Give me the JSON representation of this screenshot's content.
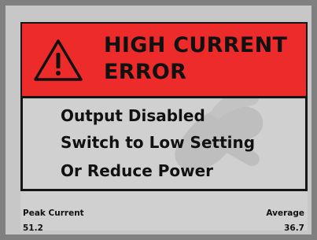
{
  "alert": {
    "title": "HIGH CURRENT ERROR",
    "icon": "warning-triangle-icon",
    "header_color": "#ee2b2b"
  },
  "messages": [
    "Output Disabled",
    "Switch to Low Setting",
    "Or Reduce Power"
  ],
  "readings": {
    "peak_label": "Peak Current",
    "peak_value": "51.2",
    "average_label": "Average",
    "average_value": "36.7"
  }
}
